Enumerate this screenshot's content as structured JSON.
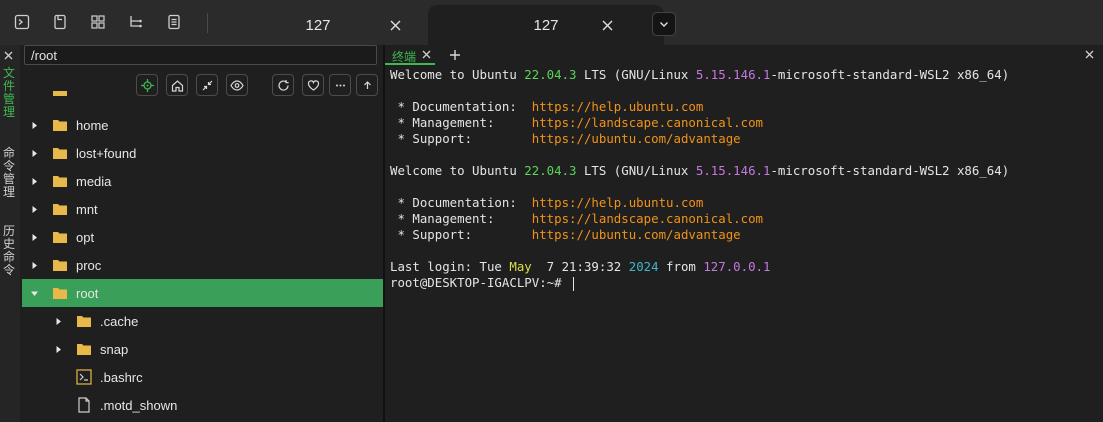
{
  "top_tabs": [
    {
      "label": "127",
      "active": false
    },
    {
      "label": "127",
      "active": true
    }
  ],
  "rail": {
    "items": [
      {
        "label": "文件管理",
        "color": "#3fb950"
      },
      {
        "label": "命令管理",
        "color": "#d0d0d0"
      },
      {
        "label": "历史命令",
        "color": "#d0d0d0"
      }
    ]
  },
  "file_panel": {
    "path": "/root",
    "tree": [
      {
        "name": "home",
        "type": "folder",
        "depth": 0,
        "expanded": false,
        "selected": false
      },
      {
        "name": "lost+found",
        "type": "folder",
        "depth": 0,
        "expanded": false,
        "selected": false
      },
      {
        "name": "media",
        "type": "folder",
        "depth": 0,
        "expanded": false,
        "selected": false
      },
      {
        "name": "mnt",
        "type": "folder",
        "depth": 0,
        "expanded": false,
        "selected": false
      },
      {
        "name": "opt",
        "type": "folder",
        "depth": 0,
        "expanded": false,
        "selected": false
      },
      {
        "name": "proc",
        "type": "folder",
        "depth": 0,
        "expanded": false,
        "selected": false
      },
      {
        "name": "root",
        "type": "folder",
        "depth": 0,
        "expanded": true,
        "selected": true
      },
      {
        "name": ".cache",
        "type": "folder",
        "depth": 1,
        "expanded": false,
        "selected": false
      },
      {
        "name": "snap",
        "type": "folder",
        "depth": 1,
        "expanded": false,
        "selected": false
      },
      {
        "name": ".bashrc",
        "type": "script",
        "depth": 1,
        "expanded": false,
        "selected": false
      },
      {
        "name": ".motd_shown",
        "type": "file",
        "depth": 1,
        "expanded": false,
        "selected": false
      }
    ]
  },
  "terminal_tab": {
    "label": "终端"
  },
  "terminal": {
    "lines": [
      [
        {
          "t": "Welcome to Ubuntu "
        },
        {
          "t": "22.04.3",
          "c": "green"
        },
        {
          "t": " LTS (GNU/Linux "
        },
        {
          "t": "5.15.146.1",
          "c": "purple"
        },
        {
          "t": "-microsoft-standard-WSL2 x86_64)"
        }
      ],
      [],
      [
        {
          "t": " * Documentation:  "
        },
        {
          "t": "https://help.ubuntu.com",
          "c": "orange"
        }
      ],
      [
        {
          "t": " * Management:     "
        },
        {
          "t": "https://landscape.canonical.com",
          "c": "orange"
        }
      ],
      [
        {
          "t": " * Support:        "
        },
        {
          "t": "https://ubuntu.com/advantage",
          "c": "orange"
        }
      ],
      [],
      [
        {
          "t": "Welcome to Ubuntu "
        },
        {
          "t": "22.04.3",
          "c": "green"
        },
        {
          "t": " LTS (GNU/Linux "
        },
        {
          "t": "5.15.146.1",
          "c": "purple"
        },
        {
          "t": "-microsoft-standard-WSL2 x86_64)"
        }
      ],
      [],
      [
        {
          "t": " * Documentation:  "
        },
        {
          "t": "https://help.ubuntu.com",
          "c": "orange"
        }
      ],
      [
        {
          "t": " * Management:     "
        },
        {
          "t": "https://landscape.canonical.com",
          "c": "orange"
        }
      ],
      [
        {
          "t": " * Support:        "
        },
        {
          "t": "https://ubuntu.com/advantage",
          "c": "orange"
        }
      ],
      [],
      [
        {
          "t": "Last login: Tue "
        },
        {
          "t": "May",
          "c": "yellow"
        },
        {
          "t": "  7 21:39:32 "
        },
        {
          "t": "2024",
          "c": "blue"
        },
        {
          "t": " from "
        },
        {
          "t": "127.0.0.1",
          "c": "purple"
        }
      ],
      [
        {
          "t": "root@DESKTOP-IGACLPV:~# "
        }
      ]
    ]
  },
  "colors": {
    "accent": "#3fb950",
    "selection": "#3a9f58",
    "folder": "#e8b84a",
    "orange_link": "#f0921a"
  }
}
